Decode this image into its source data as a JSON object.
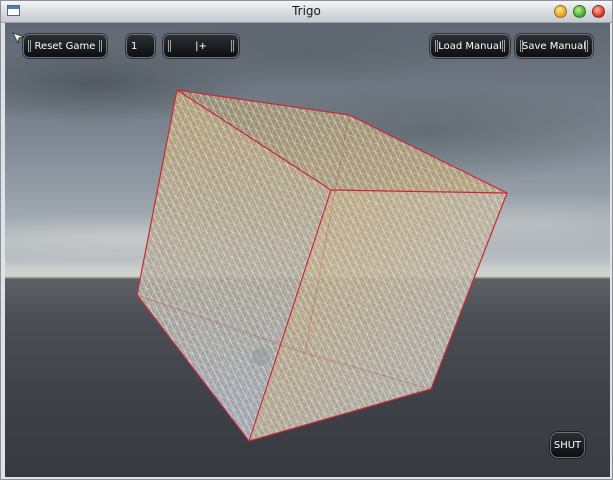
{
  "window": {
    "title": "Trigo"
  },
  "toolbar": {
    "reset_label": "Reset Game",
    "level_value": "1",
    "step_label": "|+",
    "load_label": "Load Manual",
    "save_label": "Save Manual"
  },
  "footer": {
    "shut_label": "SHUT"
  },
  "scene": {
    "object": "lattice-cube",
    "edge_color": "#c8283a",
    "fill_color": "#b49a6a",
    "grid_color": "#e8ecf2"
  },
  "icons": {
    "pointer": "pointer-icon",
    "window": "window-icon",
    "minimize": "minimize-icon",
    "maximize": "maximize-icon",
    "close": "close-icon"
  }
}
